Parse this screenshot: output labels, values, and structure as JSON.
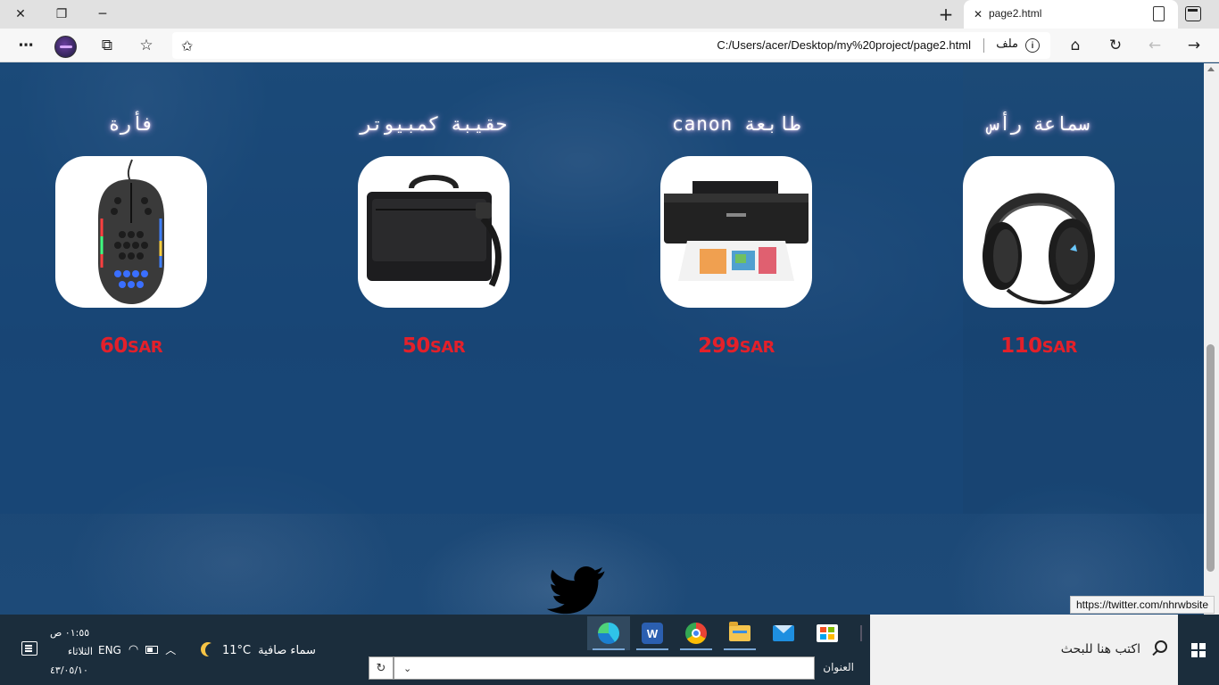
{
  "browser": {
    "tab_title": "page2.html",
    "address_url": "C:/Users/acer/Desktop/my%20project/page2.html",
    "address_file_label": "ملف",
    "status_url": "https://twitter.com/nhrwbsite"
  },
  "products": [
    {
      "title": "فأرة",
      "price": "60",
      "currency": "SAR",
      "image": "gaming-mouse"
    },
    {
      "title": "حقيبة كمبيوتر",
      "price": "50",
      "currency": "SAR",
      "image": "laptop-bag"
    },
    {
      "title": "طابعة canon",
      "price": "299",
      "currency": "SAR",
      "image": "canon-printer"
    },
    {
      "title": "سماعة رأس",
      "price": "110",
      "currency": "SAR",
      "image": "headset"
    }
  ],
  "footer": {
    "social_icon": "twitter-icon"
  },
  "taskbar": {
    "search_placeholder": "اكتب هنا للبحث",
    "address_label": "العنوان",
    "weather_text": "سماء صافية",
    "temperature": "11°C",
    "language": "ENG",
    "time": "٠١:٥٥ ص",
    "day": "الثلاثاء",
    "date": "٤٣/٠٥/١٠",
    "apps": [
      "edge",
      "word",
      "chrome",
      "file-explorer",
      "mail",
      "store"
    ]
  },
  "colors": {
    "price_red": "#e3202a",
    "page_blue": "#1c4a78",
    "taskbar": "#1b2d3c"
  }
}
